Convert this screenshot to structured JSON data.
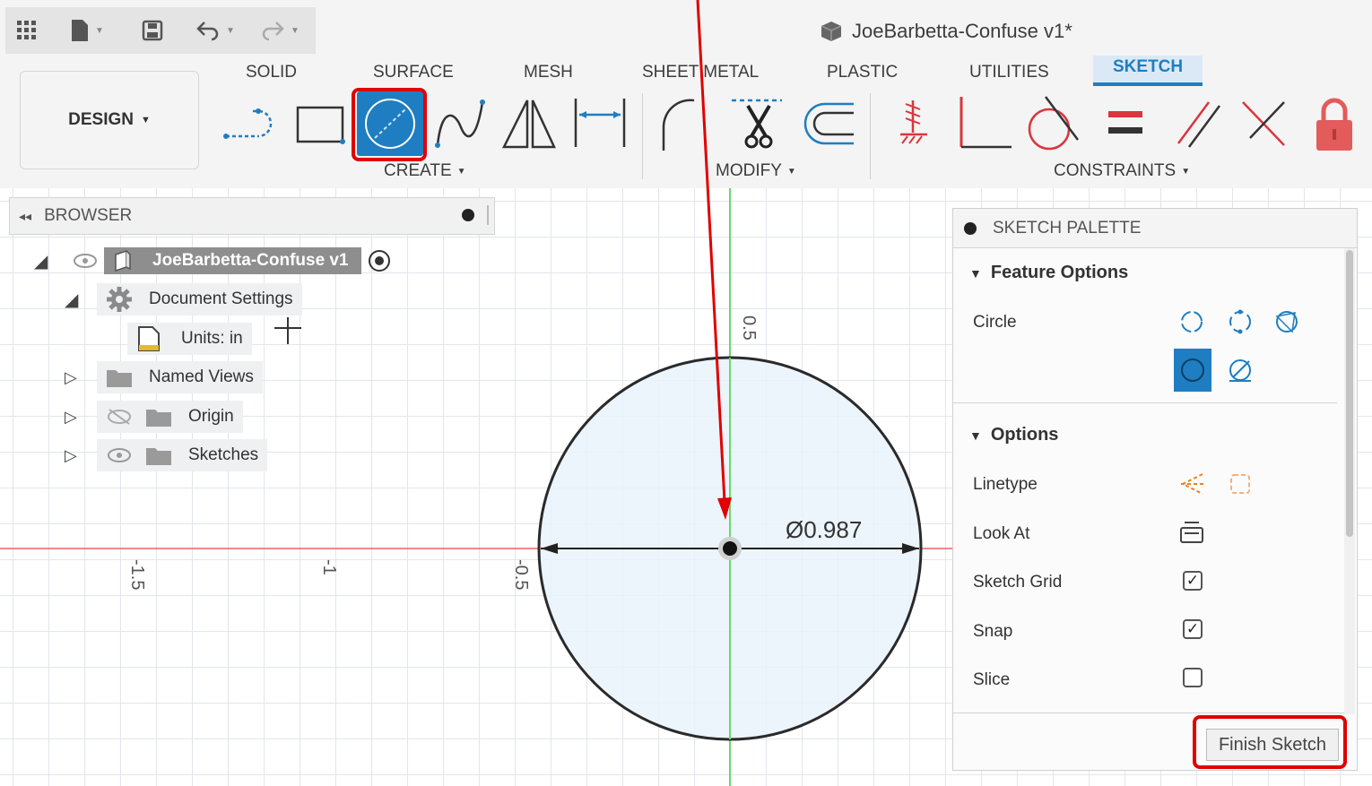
{
  "document": {
    "title": "JoeBarbetta-Confuse v1*"
  },
  "toolbar": {
    "workspace": "DESIGN",
    "tabs": [
      "SOLID",
      "SURFACE",
      "MESH",
      "SHEET METAL",
      "PLASTIC",
      "UTILITIES",
      "SKETCH"
    ],
    "active_tab": "SKETCH",
    "groups": {
      "create": "CREATE",
      "modify": "MODIFY",
      "constraints": "CONSTRAINTS"
    }
  },
  "browser": {
    "title": "BROWSER",
    "root": "JoeBarbetta-Confuse v1",
    "items": [
      {
        "label": "Document Settings"
      },
      {
        "label": "Units: in"
      },
      {
        "label": "Named Views"
      },
      {
        "label": "Origin"
      },
      {
        "label": "Sketches"
      }
    ]
  },
  "canvas": {
    "dimension": "Ø0.987",
    "axis_labels": {
      "x_neg_1_5": "-1.5",
      "x_neg_1": "-1",
      "x_neg_0_5": "-0.5",
      "y_0_5": "0.5"
    }
  },
  "palette": {
    "title": "SKETCH PALETTE",
    "feature_options": {
      "title": "Feature Options",
      "circle_label": "Circle"
    },
    "options": {
      "title": "Options",
      "rows": [
        {
          "label": "Linetype"
        },
        {
          "label": "Look At"
        },
        {
          "label": "Sketch Grid",
          "checked": true
        },
        {
          "label": "Snap",
          "checked": true
        },
        {
          "label": "Slice",
          "checked": false
        }
      ]
    },
    "finish_button": "Finish Sketch"
  },
  "colors": {
    "accent": "#1f7ec1",
    "highlight": "#e00000",
    "constraint": "#d9363e"
  }
}
